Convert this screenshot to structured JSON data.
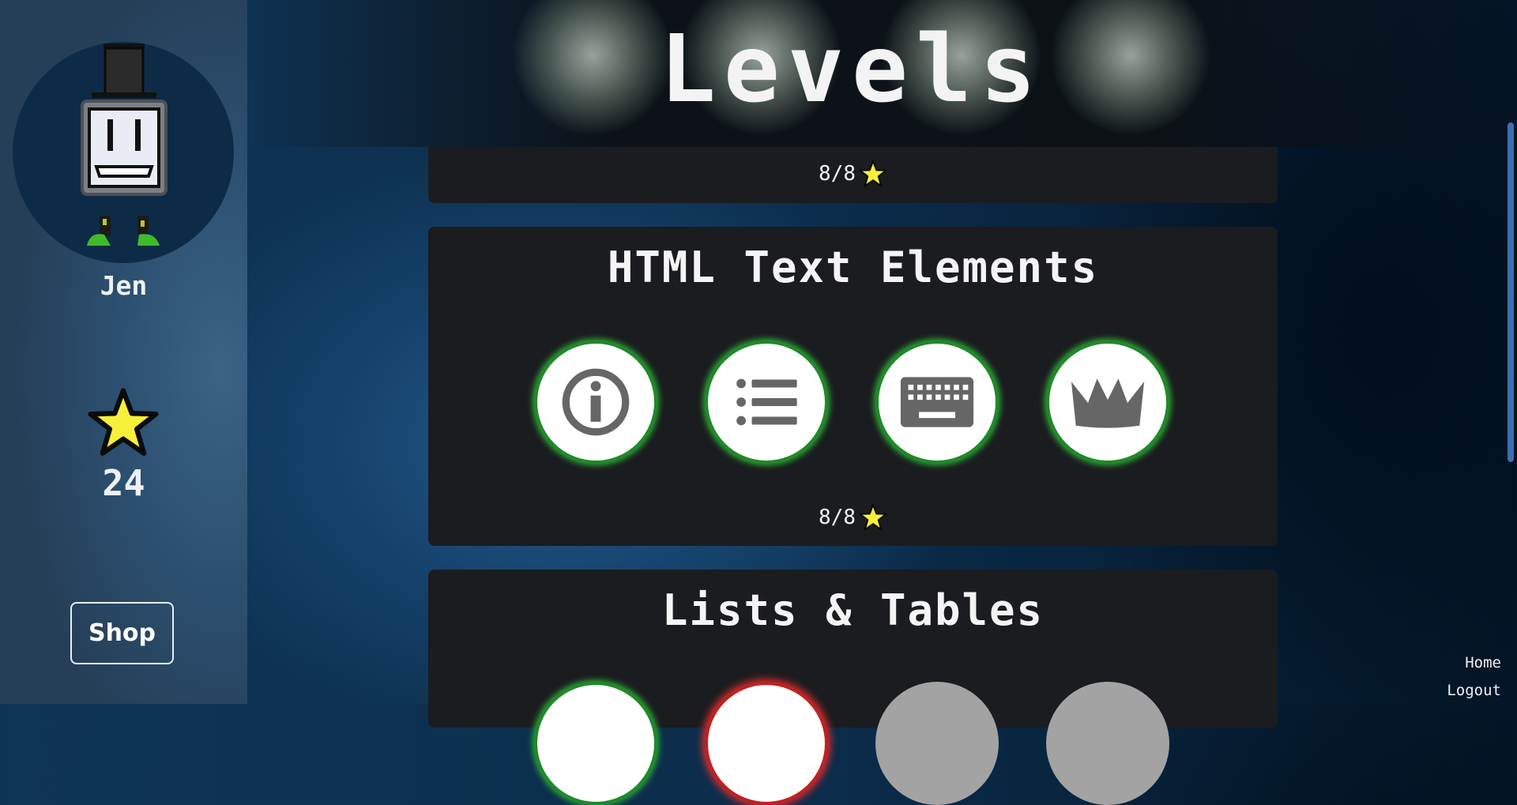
{
  "user": {
    "name": "Jen",
    "stars": "24"
  },
  "sidebar": {
    "shop_label": "Shop"
  },
  "header": {
    "title": "Levels"
  },
  "sections": [
    {
      "title": "",
      "score": "8/8"
    },
    {
      "title": "HTML Text Elements",
      "score": "8/8",
      "levels": [
        {
          "icon": "info-icon",
          "status": "completed"
        },
        {
          "icon": "list-icon",
          "status": "completed"
        },
        {
          "icon": "keyboard-icon",
          "status": "completed"
        },
        {
          "icon": "crown-icon",
          "status": "completed"
        }
      ]
    },
    {
      "title": "Lists & Tables",
      "levels": [
        {
          "status": "completed"
        },
        {
          "status": "failed"
        },
        {
          "status": "locked"
        },
        {
          "status": "locked"
        }
      ]
    }
  ],
  "nav": {
    "home": "Home",
    "logout": "Logout"
  },
  "colors": {
    "completed": "#1f8a2a",
    "failed": "#c22020",
    "locked": "#a3a3a3",
    "star": "#f6f03a"
  }
}
